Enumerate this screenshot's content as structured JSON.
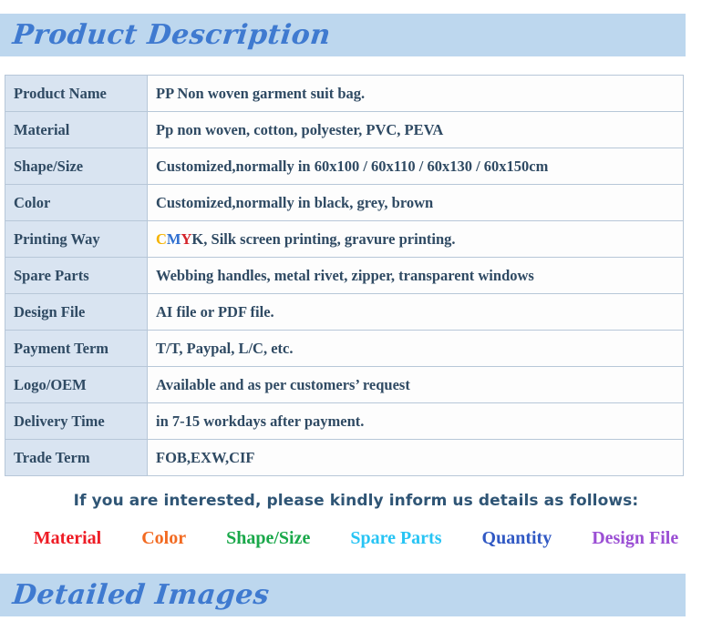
{
  "sections": {
    "product_description_title": "Product Description",
    "detailed_images_title": "Detailed Images"
  },
  "spec_table": {
    "rows": [
      {
        "label": "Product Name",
        "value": "PP Non woven garment suit bag."
      },
      {
        "label": "Material",
        "value": "Pp non woven, cotton, polyester, PVC, PEVA"
      },
      {
        "label": "Shape/Size",
        "value": "Customized,normally in 60x100 / 60x110 / 60x130 / 60x150cm"
      },
      {
        "label": "Color",
        "value": "Customized,normally in black, grey, brown"
      },
      {
        "label": "Printing Way",
        "value": "CMYK, Silk screen printing, gravure printing.",
        "value_parts": {
          "c": "C",
          "m": "M",
          "y": "Y",
          "k": "K",
          "rest": ", Silk screen printing, gravure printing."
        }
      },
      {
        "label": "Spare Parts",
        "value": "Webbing handles, metal rivet, zipper, transparent windows"
      },
      {
        "label": "Design File",
        "value": "AI file or PDF file."
      },
      {
        "label": "Payment Term",
        "value": "T/T, Paypal, L/C, etc."
      },
      {
        "label": "Logo/OEM",
        "value": "Available and as per customers’ request"
      },
      {
        "label": "Delivery Time",
        "value": "in 7-15 workdays after payment."
      },
      {
        "label": "Trade Term",
        "value": "FOB,EXW,CIF"
      }
    ]
  },
  "cta": {
    "headline": "If you are interested, please kindly inform us details as follows:",
    "keywords": [
      {
        "label": "Material",
        "color": "#ee1c25"
      },
      {
        "label": "Color",
        "color": "#f26a21"
      },
      {
        "label": "Shape/Size",
        "color": "#1aa84a"
      },
      {
        "label": "Spare Parts",
        "color": "#27c4f4"
      },
      {
        "label": "Quantity",
        "color": "#3159c4"
      },
      {
        "label": "Design File",
        "color": "#9b4fd4"
      }
    ]
  },
  "colors": {
    "banner_background": "#bdd7ee",
    "banner_text": "#3f7ad0",
    "table_label_background": "#d9e4f1",
    "table_value_background": "#fdfdfd",
    "table_border": "#b7c7d8",
    "table_text": "#2f4a63",
    "headline_text": "#2f5575",
    "cmyk_c": "#f5b301",
    "cmyk_m": "#2f6fd0",
    "cmyk_y": "#d4232a",
    "cmyk_k": "#2f4a63"
  }
}
